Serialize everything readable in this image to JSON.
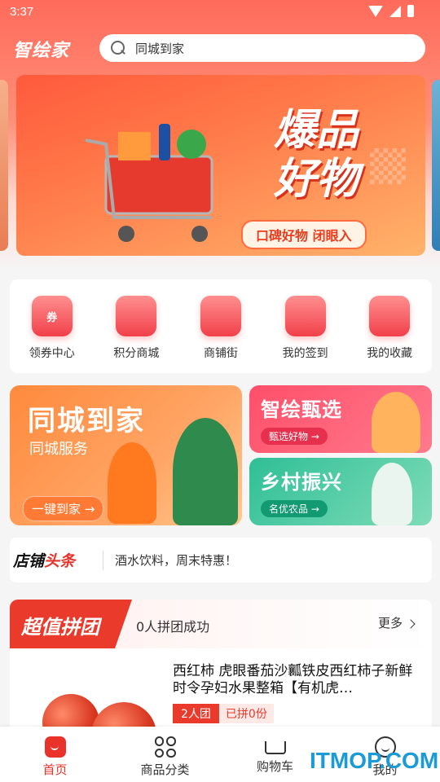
{
  "status": {
    "time": "3:37"
  },
  "header": {
    "logo": "智绘家",
    "search_value": "同城到家"
  },
  "banner": {
    "title_line1": "爆品",
    "title_line2": "好物",
    "pill": "口碑好物 闭眼入"
  },
  "quick_links": [
    {
      "label": "领券中心",
      "icon": "coupon-icon",
      "glyph": "券"
    },
    {
      "label": "积分商城",
      "icon": "shopping-bag-icon",
      "glyph": ""
    },
    {
      "label": "商铺街",
      "icon": "store-icon",
      "glyph": ""
    },
    {
      "label": "我的签到",
      "icon": "checkin-icon",
      "glyph": ""
    },
    {
      "label": "我的收藏",
      "icon": "favorites-icon",
      "glyph": ""
    }
  ],
  "promo": {
    "left": {
      "title": "同城到家",
      "subtitle": "同城服务",
      "button": "一键到家 →"
    },
    "right_top": {
      "title": "智绘甄选",
      "button": "甄选好物 →"
    },
    "right_bottom": {
      "title": "乡村振兴",
      "button": "名优农品 →"
    }
  },
  "news": {
    "logo_prefix": "店铺",
    "logo_suffix": "头条",
    "text": "酒水饮料，周末特惠！"
  },
  "group_buy": {
    "badge": "超值拼团",
    "count": "0人拼团成功",
    "more": "更多",
    "product": {
      "title": "西红柿 虎眼番茄沙瓤铁皮西红柿子新鲜时令孕妇水果整箱【有机虎…",
      "tag_group": "2人团",
      "tag_joined": "已拼0份"
    }
  },
  "tabbar": [
    {
      "label": "首页",
      "active": true
    },
    {
      "label": "商品分类",
      "active": false
    },
    {
      "label": "购物车",
      "active": false
    },
    {
      "label": "我的",
      "active": false
    }
  ],
  "watermark": "ITMOP.COM",
  "colors": {
    "accent": "#e8322a",
    "orange": "#ff8a3d",
    "green": "#2fbf96",
    "pink": "#ff4f6a"
  }
}
